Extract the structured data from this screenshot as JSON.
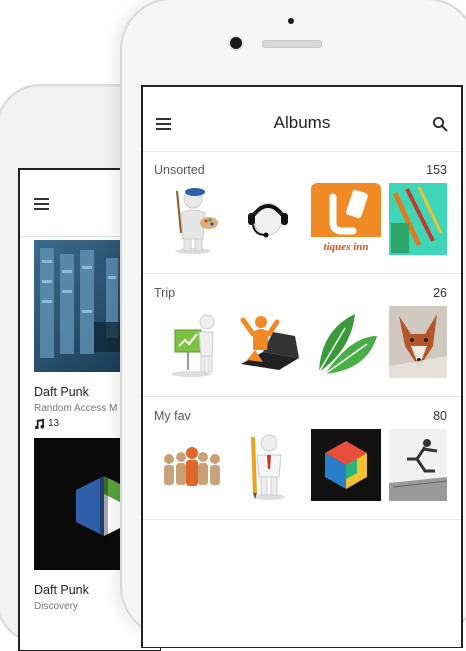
{
  "back_phone": {
    "albums": [
      {
        "title": "Daft Punk",
        "subtitle": "Random Access M",
        "count": "13",
        "count_icon": "music-note-icon"
      },
      {
        "title": "Daft Punk",
        "subtitle": "Discovery"
      }
    ]
  },
  "header": {
    "title": "Albums",
    "menu_icon": "hamburger-icon",
    "search_icon": "search-icon"
  },
  "sections": [
    {
      "label": "Unsorted",
      "count": "153"
    },
    {
      "label": "Trip",
      "count": "26"
    },
    {
      "label": "My fav",
      "count": "80"
    }
  ],
  "logo_text": "tiques inn",
  "colors": {
    "logo_orange": "#f08a24",
    "leaf_green": "#3a9a3a",
    "screen_border": "#222222"
  }
}
